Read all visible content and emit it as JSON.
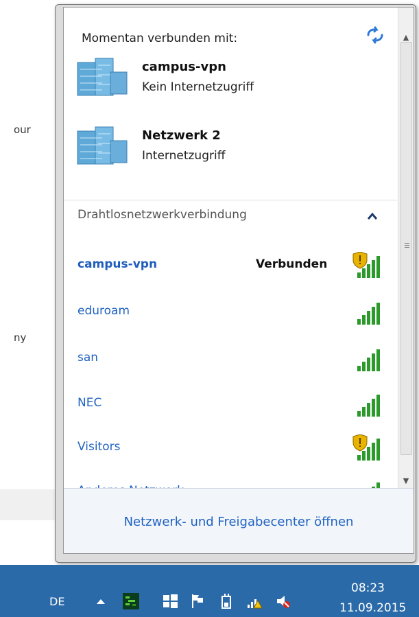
{
  "background": {
    "left_texts": [
      "our",
      "ny"
    ]
  },
  "panel": {
    "header": "Momentan verbunden mit:",
    "connected_networks": [
      {
        "name": "campus-vpn",
        "status": "Kein Internetzugriff",
        "icon": "server-network-icon"
      },
      {
        "name": "Netzwerk  2",
        "status": "Internetzugriff",
        "icon": "server-network-icon"
      }
    ],
    "wireless_section_title": "Drahtlosnetzwerkverbindung",
    "wireless_networks": [
      {
        "name": "campus-vpn",
        "status": "Verbunden",
        "secured_warning": true
      },
      {
        "name": "eduroam",
        "status": "",
        "secured_warning": false
      },
      {
        "name": "san",
        "status": "",
        "secured_warning": false
      },
      {
        "name": "NEC",
        "status": "",
        "secured_warning": false
      },
      {
        "name": "Visitors",
        "status": "",
        "secured_warning": true
      },
      {
        "name": "Anderes Netzwerk",
        "status": "",
        "secured_warning": false
      }
    ],
    "footer_link": "Netzwerk- und Freigabecenter öffnen"
  },
  "taskbar": {
    "language": "DE",
    "time": "08:23",
    "date": "11.09.2015",
    "color": "#2b6aa8"
  }
}
